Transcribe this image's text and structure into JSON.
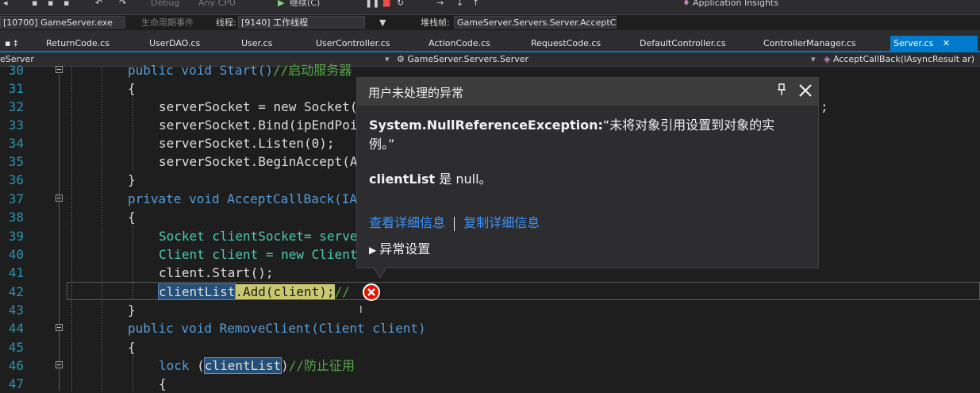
{
  "toolbar": {
    "process": "[10700] GameServer.exe",
    "config": "Debug",
    "platform": "Any CPU",
    "continue_label": "继续(C)",
    "lifecycle_label": "生命周期事件",
    "thread_label": "线程:",
    "thread_value": "[9140] 工作线程",
    "stackframe_label": "堆栈帧:",
    "stackframe_value": "GameServer.Servers.Server.AcceptCall",
    "app_insights": "Application Insights"
  },
  "tabs": [
    {
      "label": "ReturnCode.cs"
    },
    {
      "label": "UserDAO.cs"
    },
    {
      "label": "User.cs"
    },
    {
      "label": "UserController.cs"
    },
    {
      "label": "ActionCode.cs"
    },
    {
      "label": "RequestCode.cs"
    },
    {
      "label": "DefaultController.cs"
    },
    {
      "label": "ControllerManager.cs"
    },
    {
      "label": "Server.cs"
    }
  ],
  "navbar": {
    "project": "eServer",
    "class_path": "GameServer.Servers.Server",
    "member": "AcceptCallBack(IAsyncResult ar)"
  },
  "line_numbers": [
    "30",
    "31",
    "32",
    "33",
    "34",
    "35",
    "36",
    "37",
    "38",
    "39",
    "40",
    "41",
    "42",
    "43",
    "44",
    "45",
    "46",
    "47"
  ],
  "code": {
    "l30_pre": "public void Start()",
    "l30_cm": "//启动服务器",
    "l31": "{",
    "l32": "serverSocket = new Socket(",
    "l33": "serverSocket.Bind(ipEndPoi",
    "l34": "serverSocket.Listen(0);",
    "l35": "serverSocket.BeginAccept(Ac",
    "l36": "}",
    "l37": "private void AcceptCallBack(IAs",
    "l38": "{",
    "l39": "Socket clientSocket= server",
    "l40": "Client client = new Client",
    "l41": "client.Start();",
    "l42_sel": "clientList",
    "l42_rest": ".Add(client);",
    "l42_cm": "//",
    "l43": "}",
    "l44": "public void RemoveClient(Client client)",
    "l45": "{",
    "l46_kw": "lock",
    "l46_ref": "clientList",
    "l46_cm": "//防止征用",
    "l47": "{",
    "l32_tail": ";"
  },
  "exception": {
    "title": "用户未处理的异常",
    "type": "System.NullReferenceException:",
    "message": "“未将对象引用设置到对象的实",
    "message_cont": "例。”",
    "detail_bold": "clientList",
    "detail_rest": " 是 null。",
    "view_details": "查看详细信息",
    "copy_details": "复制详细信息",
    "settings": "异常设置"
  }
}
